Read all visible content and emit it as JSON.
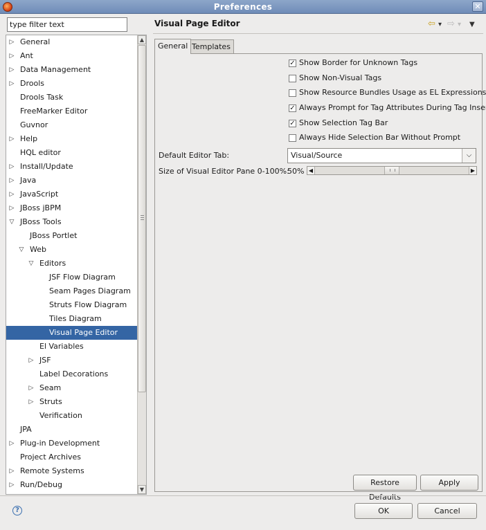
{
  "window": {
    "title": "Preferences"
  },
  "filter": {
    "value": "type filter text"
  },
  "tree": [
    {
      "label": "General",
      "depth": 0,
      "arrow": "▷"
    },
    {
      "label": "Ant",
      "depth": 0,
      "arrow": "▷"
    },
    {
      "label": "Data Management",
      "depth": 0,
      "arrow": "▷"
    },
    {
      "label": "Drools",
      "depth": 0,
      "arrow": "▷"
    },
    {
      "label": "Drools Task",
      "depth": 0,
      "arrow": ""
    },
    {
      "label": "FreeMarker Editor",
      "depth": 0,
      "arrow": ""
    },
    {
      "label": "Guvnor",
      "depth": 0,
      "arrow": ""
    },
    {
      "label": "Help",
      "depth": 0,
      "arrow": "▷"
    },
    {
      "label": "HQL editor",
      "depth": 0,
      "arrow": ""
    },
    {
      "label": "Install/Update",
      "depth": 0,
      "arrow": "▷"
    },
    {
      "label": "Java",
      "depth": 0,
      "arrow": "▷"
    },
    {
      "label": "JavaScript",
      "depth": 0,
      "arrow": "▷"
    },
    {
      "label": "JBoss jBPM",
      "depth": 0,
      "arrow": "▷"
    },
    {
      "label": "JBoss Tools",
      "depth": 0,
      "arrow": "▽"
    },
    {
      "label": "JBoss Portlet",
      "depth": 1,
      "arrow": ""
    },
    {
      "label": "Web",
      "depth": 1,
      "arrow": "▽"
    },
    {
      "label": "Editors",
      "depth": 2,
      "arrow": "▽"
    },
    {
      "label": "JSF Flow Diagram",
      "depth": 3,
      "arrow": ""
    },
    {
      "label": "Seam Pages Diagram",
      "depth": 3,
      "arrow": ""
    },
    {
      "label": "Struts Flow Diagram",
      "depth": 3,
      "arrow": ""
    },
    {
      "label": "Tiles Diagram",
      "depth": 3,
      "arrow": ""
    },
    {
      "label": "Visual Page Editor",
      "depth": 3,
      "arrow": "",
      "selected": true
    },
    {
      "label": "El Variables",
      "depth": 2,
      "arrow": ""
    },
    {
      "label": "JSF",
      "depth": 2,
      "arrow": "▷"
    },
    {
      "label": "Label Decorations",
      "depth": 2,
      "arrow": ""
    },
    {
      "label": "Seam",
      "depth": 2,
      "arrow": "▷"
    },
    {
      "label": "Struts",
      "depth": 2,
      "arrow": "▷"
    },
    {
      "label": "Verification",
      "depth": 2,
      "arrow": ""
    },
    {
      "label": "JPA",
      "depth": 0,
      "arrow": ""
    },
    {
      "label": "Plug-in Development",
      "depth": 0,
      "arrow": "▷"
    },
    {
      "label": "Project Archives",
      "depth": 0,
      "arrow": ""
    },
    {
      "label": "Remote Systems",
      "depth": 0,
      "arrow": "▷"
    },
    {
      "label": "Run/Debug",
      "depth": 0,
      "arrow": "▷"
    }
  ],
  "page": {
    "title": "Visual Page Editor",
    "tabs": [
      "General",
      "Templates"
    ],
    "options": [
      {
        "label": "Show Border for Unknown Tags",
        "checked": true
      },
      {
        "label": "Show Non-Visual Tags",
        "checked": false
      },
      {
        "label": "Show Resource Bundles Usage as EL Expressions",
        "checked": false
      },
      {
        "label": "Always Prompt for Tag Attributes During Tag Insert",
        "checked": true
      },
      {
        "label": "Show Selection Tag Bar",
        "checked": true
      },
      {
        "label": "Always Hide Selection Bar Without Prompt",
        "checked": false
      }
    ],
    "default_tab_label": "Default Editor Tab:",
    "default_tab_value": "Visual/Source",
    "pane_size_label": "Size of Visual Editor Pane 0-100%:",
    "pane_size_value": "50%",
    "pane_size_fraction": 0.5,
    "restore_label": "Restore Defaults",
    "apply_label": "Apply"
  },
  "footer": {
    "ok_label": "OK",
    "cancel_label": "Cancel"
  },
  "icons": {
    "back": "⇦",
    "back_menu": "▾",
    "forward": "⇨",
    "forward_menu": "▾",
    "view_menu": "▼",
    "help": "?",
    "close": "✕",
    "dropdown": "⌵",
    "scroll_up": "▲",
    "scroll_down": "▼",
    "scroll_left": "◀",
    "scroll_right": "▶",
    "check": "✓"
  }
}
